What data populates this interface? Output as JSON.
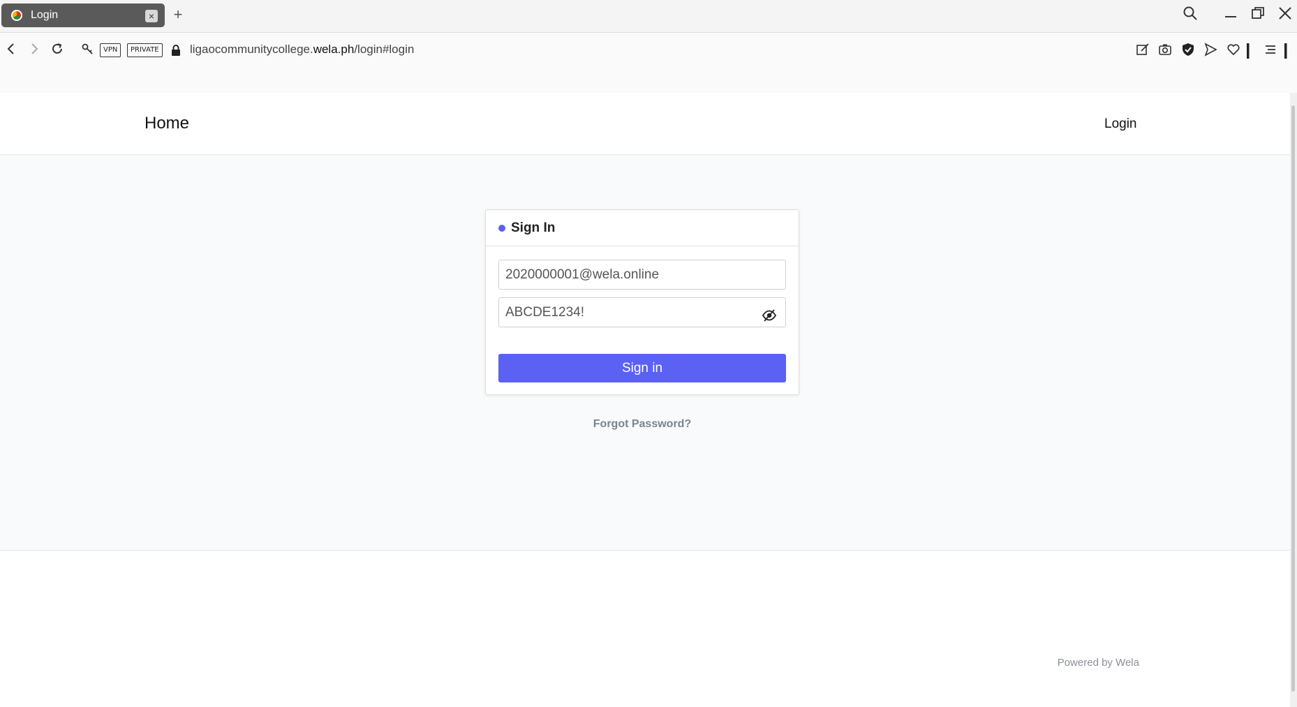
{
  "browser": {
    "tab_title": "Login",
    "tab_close": "×",
    "new_tab": "+",
    "badges": {
      "vpn": "VPN",
      "private": "PRIVATE"
    },
    "url_prefix": "ligaocommunitycollege.",
    "url_domain": "wela.ph",
    "url_path": "/login#login",
    "icons": [
      "back-icon",
      "forward-icon",
      "reload-icon",
      "key-icon",
      "lock-icon",
      "search-icon",
      "minimize-icon",
      "restore-icon",
      "close-icon",
      "edit-icon",
      "camera-icon",
      "shield-icon",
      "send-icon",
      "heart-icon",
      "menu-icon"
    ]
  },
  "navbar": {
    "home": "Home",
    "login": "Login"
  },
  "signin": {
    "title": "Sign In",
    "email_value": "2020000001@wela.online",
    "password_value": "ABCDE1234!",
    "button": "Sign in",
    "accent": "#5b61f3"
  },
  "forgot_password": "Forgot Password?",
  "footer": {
    "powered_by": "Powered by Wela"
  }
}
